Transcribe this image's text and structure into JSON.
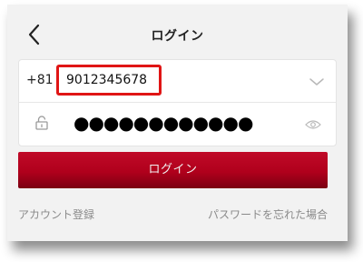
{
  "header": {
    "title": "ログイン",
    "back_icon": "chevron-left-icon"
  },
  "form": {
    "country_code": "+81",
    "phone_value": "9012345678",
    "password_value": "●●●●●●●●●●●●",
    "country_dropdown_icon": "chevron-down-icon",
    "lock_icon": "lock-icon",
    "show_password_icon": "eye-icon"
  },
  "actions": {
    "login_label": "ログイン",
    "register_label": "アカウント登録",
    "forgot_label": "パスワードを忘れた場合"
  },
  "colors": {
    "accent": "#b0001c",
    "highlight_border": "#e01515",
    "background": "#f2f2f2",
    "link_text": "#8a8a8a"
  }
}
